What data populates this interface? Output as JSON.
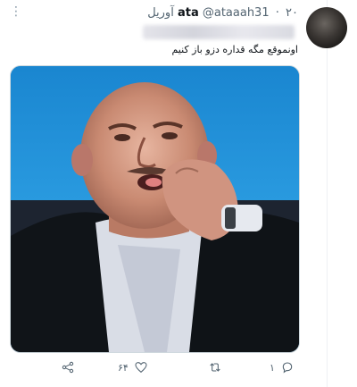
{
  "header": {
    "name": "ata",
    "handle": "@ataaah31",
    "date": "۲۰ آوریل"
  },
  "tweet": {
    "text": "اونموقع مگه قداره دزو باز کنیم"
  },
  "actions": {
    "reply_count": "۱",
    "like_count": "۶۴"
  },
  "icons": {
    "more": "more-icon",
    "reply": "reply-icon",
    "retweet": "retweet-icon",
    "like": "heart-icon",
    "share": "share-icon"
  },
  "colors": {
    "text": "#0f1419",
    "muted": "#536471",
    "media_bg": "#1f8fd6"
  }
}
